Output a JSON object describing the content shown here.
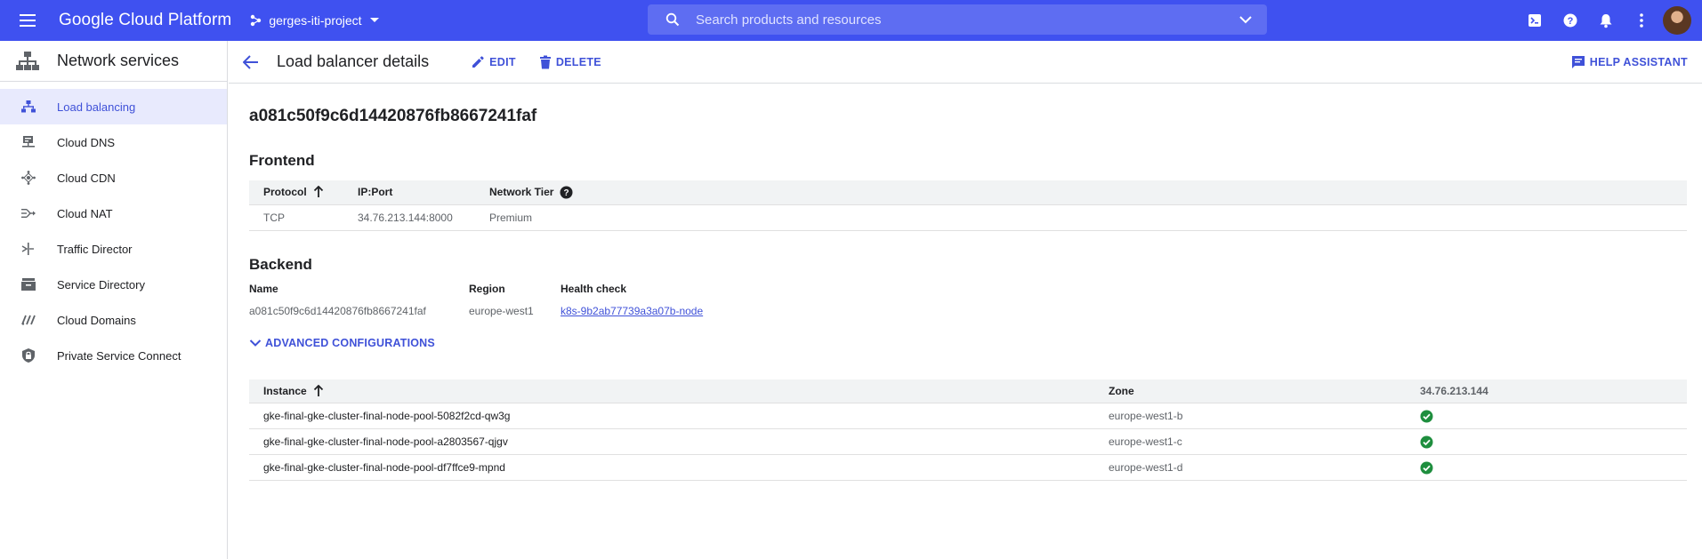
{
  "topbar": {
    "brand": "Google Cloud Platform",
    "project": "gerges-iti-project",
    "search_placeholder": "Search products and resources",
    "icons": [
      "menu-icon",
      "project-dots-icon",
      "search-icon",
      "expand-icon",
      "cloud-shell-icon",
      "help-icon",
      "notifications-icon",
      "more-vert-icon"
    ]
  },
  "sidebar": {
    "title": "Network services",
    "items": [
      {
        "label": "Load balancing",
        "icon": "load-balancing-icon",
        "active": true
      },
      {
        "label": "Cloud DNS",
        "icon": "dns-icon"
      },
      {
        "label": "Cloud CDN",
        "icon": "cdn-icon"
      },
      {
        "label": "Cloud NAT",
        "icon": "nat-icon"
      },
      {
        "label": "Traffic Director",
        "icon": "traffic-director-icon"
      },
      {
        "label": "Service Directory",
        "icon": "service-directory-icon"
      },
      {
        "label": "Cloud Domains",
        "icon": "domains-icon"
      },
      {
        "label": "Private Service Connect",
        "icon": "private-service-connect-icon"
      }
    ]
  },
  "actionbar": {
    "title": "Load balancer details",
    "edit": "EDIT",
    "delete": "DELETE",
    "help": "HELP ASSISTANT"
  },
  "lb_name": "a081c50f9c6d14420876fb8667241faf",
  "frontend": {
    "title": "Frontend",
    "headers": [
      "Protocol",
      "IP:Port",
      "Network Tier"
    ],
    "rows": [
      {
        "protocol": "TCP",
        "ip_port": "34.76.213.144:8000",
        "tier": "Premium"
      }
    ]
  },
  "backend": {
    "title": "Backend",
    "headers": [
      "Name",
      "Region",
      "Health check"
    ],
    "name": "a081c50f9c6d14420876fb8667241faf",
    "region": "europe-west1",
    "health_check": "k8s-9b2ab77739a3a07b-node"
  },
  "advanced": "ADVANCED CONFIGURATIONS",
  "instances": {
    "headers": [
      "Instance",
      "Zone",
      "34.76.213.144"
    ],
    "rows": [
      {
        "instance": "gke-final-gke-cluster-final-node-pool-5082f2cd-qw3g",
        "zone": "europe-west1-b",
        "healthy": true
      },
      {
        "instance": "gke-final-gke-cluster-final-node-pool-a2803567-qjgv",
        "zone": "europe-west1-c",
        "healthy": true
      },
      {
        "instance": "gke-final-gke-cluster-final-node-pool-df7ffce9-mpnd",
        "zone": "europe-west1-d",
        "healthy": true
      }
    ]
  },
  "colors": {
    "topbar": "#3f51f0",
    "accent": "#3f51d8",
    "healthy": "#1e8e3e"
  }
}
